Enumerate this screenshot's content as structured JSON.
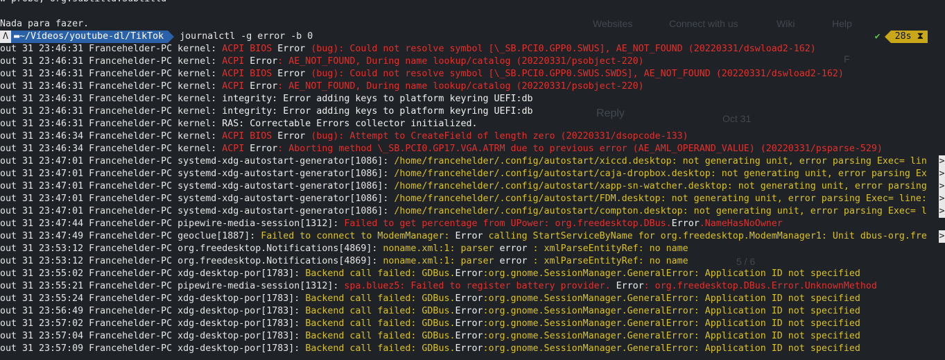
{
  "ghost": {
    "websites": "Websites",
    "connect": "Connect with us",
    "wiki": "Wiki",
    "help": "Help",
    "reply": "Reply",
    "date": "Oct 31",
    "counter": "5 / 6",
    "avatar": "F"
  },
  "top_line": "w-probe, org.subtitld.Subtitld",
  "nothing": "Nada para fazer.",
  "prompt": {
    "os_icon": "ὂ7",
    "dir": "~/Vídeos/youtube-dl/TikTok",
    "command": "journalctl -g error -b 0",
    "status_ok": "✔",
    "elapsed": "28s",
    "hourglass": "⧗"
  },
  "log": [
    {
      "p": "out 31 23:46:31 Francehelder-PC kernel: ",
      "s": [
        {
          "c": "red",
          "t": "ACPI BIOS "
        },
        {
          "c": "wht",
          "t": "Error"
        },
        {
          "c": "red",
          "t": " (bug): Could not resolve symbol [\\_SB.PCI0.GPP0.SWUS], AE_NOT_FOUND (20220331/dswload2-162)"
        }
      ]
    },
    {
      "p": "out 31 23:46:31 Francehelder-PC kernel: ",
      "s": [
        {
          "c": "red",
          "t": "ACPI "
        },
        {
          "c": "wht",
          "t": "Error"
        },
        {
          "c": "red",
          "t": ": AE_NOT_FOUND, During name lookup/catalog (20220331/psobject-220)"
        }
      ]
    },
    {
      "p": "out 31 23:46:31 Francehelder-PC kernel: ",
      "s": [
        {
          "c": "red",
          "t": "ACPI BIOS "
        },
        {
          "c": "wht",
          "t": "Error"
        },
        {
          "c": "red",
          "t": " (bug): Could not resolve symbol [\\_SB.PCI0.GPP0.SWUS.SWDS], AE_NOT_FOUND (20220331/dswload2-162)"
        }
      ]
    },
    {
      "p": "out 31 23:46:31 Francehelder-PC kernel: ",
      "s": [
        {
          "c": "red",
          "t": "ACPI "
        },
        {
          "c": "wht",
          "t": "Error"
        },
        {
          "c": "red",
          "t": ": AE_NOT_FOUND, During name lookup/catalog (20220331/psobject-220)"
        }
      ]
    },
    {
      "p": "out 31 23:46:31 Francehelder-PC kernel: ",
      "s": [
        {
          "c": "wht",
          "t": "integrity: Error adding keys to platform keyring UEFI:db"
        }
      ]
    },
    {
      "p": "out 31 23:46:31 Francehelder-PC kernel: ",
      "s": [
        {
          "c": "wht",
          "t": "integrity: Error adding keys to platform keyring UEFI:db"
        }
      ]
    },
    {
      "p": "out 31 23:46:31 Francehelder-PC kernel: ",
      "s": [
        {
          "c": "wht",
          "t": "RAS: Correctable Errors collector initialized."
        }
      ]
    },
    {
      "p": "out 31 23:46:34 Francehelder-PC kernel: ",
      "s": [
        {
          "c": "red",
          "t": "ACPI BIOS "
        },
        {
          "c": "wht",
          "t": "Error"
        },
        {
          "c": "red",
          "t": " (bug): Attempt to CreateField of length zero (20220331/dsopcode-133)"
        }
      ]
    },
    {
      "p": "out 31 23:46:34 Francehelder-PC kernel: ",
      "s": [
        {
          "c": "red",
          "t": "ACPI "
        },
        {
          "c": "wht",
          "t": "Error"
        },
        {
          "c": "red",
          "t": ": Aborting method \\_SB.PCI0.GP17.VGA.ATRM due to previous error (AE_AML_OPERAND_VALUE) (20220331/psparse-529)"
        }
      ]
    },
    {
      "p": "out 31 23:47:01 Francehelder-PC systemd-xdg-autostart-generator[1086]: ",
      "s": [
        {
          "c": "yel",
          "t": "/home/francehelder/.config/autostart/xiccd.desktop: not generating unit, error parsing Exec= lin"
        }
      ],
      "trunc": true
    },
    {
      "p": "out 31 23:47:01 Francehelder-PC systemd-xdg-autostart-generator[1086]: ",
      "s": [
        {
          "c": "yel",
          "t": "/home/francehelder/.config/autostart/caja-dropbox.desktop: not generating unit, error parsing Ex"
        }
      ],
      "trunc": true
    },
    {
      "p": "out 31 23:47:01 Francehelder-PC systemd-xdg-autostart-generator[1086]: ",
      "s": [
        {
          "c": "yel",
          "t": "/home/francehelder/.config/autostart/xapp-sn-watcher.desktop: not generating unit, error parsing"
        }
      ],
      "trunc": true
    },
    {
      "p": "out 31 23:47:01 Francehelder-PC systemd-xdg-autostart-generator[1086]: ",
      "s": [
        {
          "c": "yel",
          "t": "/home/francehelder/.config/autostart/FDM.desktop: not generating unit, error parsing Exec= line:"
        }
      ],
      "trunc": true
    },
    {
      "p": "out 31 23:47:01 Francehelder-PC systemd-xdg-autostart-generator[1086]: ",
      "s": [
        {
          "c": "yel",
          "t": "/home/francehelder/.config/autostart/compton.desktop: not generating unit, error parsing Exec= l"
        }
      ],
      "trunc": true
    },
    {
      "p": "out 31 23:47:44 Francehelder-PC pipewire-media-session[1312]: ",
      "s": [
        {
          "c": "red",
          "t": "Failed to get percentage from UPower: org.freedesktop.DBus."
        },
        {
          "c": "wht",
          "t": "Error"
        },
        {
          "c": "red",
          "t": ".NameHasNoOwner"
        }
      ]
    },
    {
      "p": "out 31 23:47:49 Francehelder-PC geoclue[1887]: ",
      "s": [
        {
          "c": "yel",
          "t": "Failed to connect to ModemManager: "
        },
        {
          "c": "wht",
          "t": "Error"
        },
        {
          "c": "yel",
          "t": " calling StartServiceByName for org.freedesktop.ModemManager1: Unit dbus-org.fre"
        }
      ],
      "trunc": true
    },
    {
      "p": "out 31 23:53:12 Francehelder-PC org.freedesktop.Notifications[4869]: ",
      "s": [
        {
          "c": "yel",
          "t": "noname.xml:1: parser "
        },
        {
          "c": "wht",
          "t": "error"
        },
        {
          "c": "yel",
          "t": " : xmlParseEntityRef: no name"
        }
      ]
    },
    {
      "p": "out 31 23:53:12 Francehelder-PC org.freedesktop.Notifications[4869]: ",
      "s": [
        {
          "c": "yel",
          "t": "noname.xml:1: parser "
        },
        {
          "c": "wht",
          "t": "error"
        },
        {
          "c": "yel",
          "t": " : xmlParseEntityRef: no name"
        }
      ]
    },
    {
      "p": "out 31 23:55:02 Francehelder-PC xdg-desktop-por[1783]: ",
      "s": [
        {
          "c": "yel",
          "t": "Backend call failed: GDBus."
        },
        {
          "c": "wht",
          "t": "Error"
        },
        {
          "c": "yel",
          "t": ":org.gnome.SessionManager.GeneralError: Application ID not specified"
        }
      ]
    },
    {
      "p": "out 31 23:55:21 Francehelder-PC pipewire-media-session[1312]: ",
      "s": [
        {
          "c": "red",
          "t": "spa.bluez5: Failed to register battery provider. "
        },
        {
          "c": "wht",
          "t": "Error"
        },
        {
          "c": "red",
          "t": ": org.freedesktop.DBus.Error.UnknownMethod"
        }
      ]
    },
    {
      "p": "out 31 23:55:24 Francehelder-PC xdg-desktop-por[1783]: ",
      "s": [
        {
          "c": "yel",
          "t": "Backend call failed: GDBus."
        },
        {
          "c": "wht",
          "t": "Error"
        },
        {
          "c": "yel",
          "t": ":org.gnome.SessionManager.GeneralError: Application ID not specified"
        }
      ]
    },
    {
      "p": "out 31 23:56:49 Francehelder-PC xdg-desktop-por[1783]: ",
      "s": [
        {
          "c": "yel",
          "t": "Backend call failed: GDBus."
        },
        {
          "c": "wht",
          "t": "Error"
        },
        {
          "c": "yel",
          "t": ":org.gnome.SessionManager.GeneralError: Application ID not specified"
        }
      ]
    },
    {
      "p": "out 31 23:57:02 Francehelder-PC xdg-desktop-por[1783]: ",
      "s": [
        {
          "c": "yel",
          "t": "Backend call failed: GDBus."
        },
        {
          "c": "wht",
          "t": "Error"
        },
        {
          "c": "yel",
          "t": ":org.gnome.SessionManager.GeneralError: Application ID not specified"
        }
      ]
    },
    {
      "p": "out 31 23:57:04 Francehelder-PC xdg-desktop-por[1783]: ",
      "s": [
        {
          "c": "yel",
          "t": "Backend call failed: GDBus."
        },
        {
          "c": "wht",
          "t": "Error"
        },
        {
          "c": "yel",
          "t": ":org.gnome.SessionManager.GeneralError: Application ID not specified"
        }
      ]
    },
    {
      "p": "out 31 23:57:09 Francehelder-PC xdg-desktop-por[1783]: ",
      "s": [
        {
          "c": "yel",
          "t": "Backend call failed: GDBus."
        },
        {
          "c": "wht",
          "t": "Error"
        },
        {
          "c": "yel",
          "t": ":org.gnome.SessionManager.GeneralError: Application ID not specified"
        }
      ]
    }
  ]
}
